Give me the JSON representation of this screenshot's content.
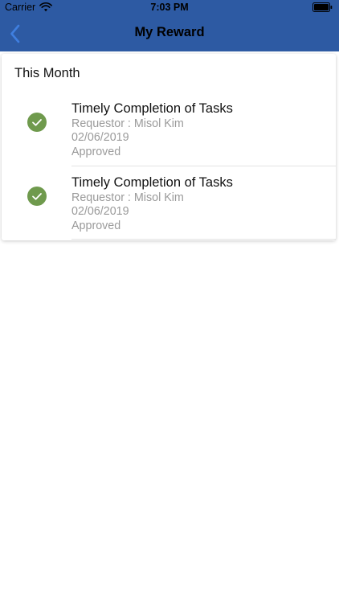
{
  "status_bar": {
    "carrier": "Carrier",
    "time": "7:03 PM"
  },
  "nav": {
    "title": "My Reward"
  },
  "section": {
    "title": "This Month"
  },
  "rewards": [
    {
      "title": "Timely Completion of Tasks",
      "requestor": "Requestor : Misol Kim",
      "date": "02/06/2019",
      "status": "Approved"
    },
    {
      "title": "Timely Completion of Tasks",
      "requestor": "Requestor : Misol Kim",
      "date": "02/06/2019",
      "status": "Approved"
    }
  ],
  "colors": {
    "header": "#2d5aa3",
    "check": "#6f9a4d",
    "back": "#3f7fe0"
  }
}
